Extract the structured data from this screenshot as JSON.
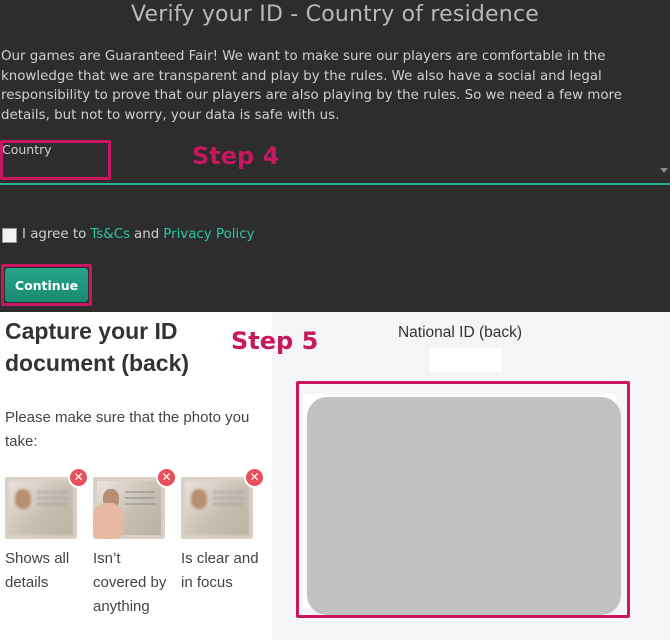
{
  "verify": {
    "title": "Verify your ID - Country of residence",
    "intro": "Our games are Guaranteed Fair! We want to make sure our players are comfortable in the knowledge that we are transparent and play by the rules. We also have a social and legal responsibility to prove that our players are also playing by the rules. So we need a few more details, but not to worry, your data is safe with us.",
    "country_label": "Country",
    "agree_text": "I agree to",
    "tcs_link": "Ts&Cs",
    "and_text": "and",
    "privacy_link": "Privacy Policy",
    "continue_label": "Continue"
  },
  "annotations": {
    "step4": "Step 4",
    "step5": "Step 5",
    "highlight_color": "#c8175f"
  },
  "capture": {
    "title": "Capture your ID document (back)",
    "instruction": "Please make sure that the photo you take:",
    "examples": [
      {
        "caption": "Shows all details",
        "icon": "x-mark-icon"
      },
      {
        "caption": "Isn’t covered by anything",
        "icon": "x-mark-icon"
      },
      {
        "caption": "Is clear and in focus",
        "icon": "x-mark-icon"
      }
    ],
    "x_symbol": "✕"
  },
  "preview": {
    "title": "National ID (back)"
  },
  "colors": {
    "accent": "#2fc3a6",
    "button": "#1f9a80",
    "dark_bg": "#2d2d2d",
    "error_badge": "#e9505f"
  }
}
